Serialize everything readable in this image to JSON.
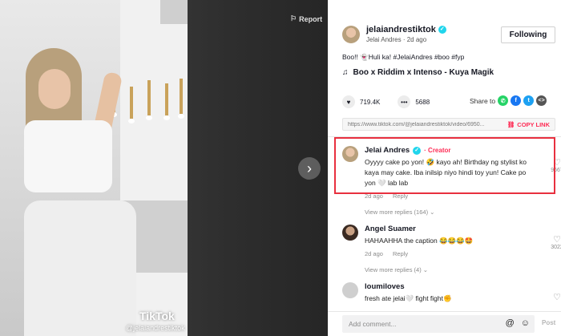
{
  "player": {
    "report_label": "Report",
    "tiktok_logo_text": "TikTok",
    "watermark_handle": "@jelaiandrestiktok"
  },
  "post": {
    "username": "jelaiandrestiktok",
    "display_name": "Jelai Andres",
    "age": "2d ago",
    "follow_label": "Following",
    "caption": "Boo!! 👻Huli ka! #JelaiAndres #boo #fyp",
    "music_title": "Boo x Riddim x Intenso - Kuya Magik",
    "likes": "719.4K",
    "comments_count": "5688",
    "share_label": "Share to",
    "share_icons": [
      "whatsapp-icon",
      "facebook-icon",
      "twitter-icon",
      "embed-icon"
    ],
    "link_url": "https://www.tiktok.com/@jelaiandrestiktok/video/6950...",
    "copy_link_label": "COPY LINK"
  },
  "comments": [
    {
      "name": "Jelai Andres",
      "badge": "· Creator",
      "text": "Oyyyy cake po yon! 🤣 kayo ah! Birthday ng stylist ko kaya may cake. Iba inilsip niyo hindi toy yun! Cake po yon 🤍 lab lab",
      "date": "2d ago",
      "reply_label": "Reply",
      "likes": "9667",
      "view_more": "View more replies (164) ⌄"
    },
    {
      "name": "Angel Suamer",
      "text": "HAHAAHHA the caption 😂😂😂🤩",
      "date": "2d ago",
      "reply_label": "Reply",
      "likes": "3022",
      "view_more": "View more replies (4) ⌄"
    },
    {
      "name": "loumiloves",
      "text": "fresh ate jelai🤍 fight fight✊",
      "date": "",
      "reply_label": "",
      "likes": "",
      "view_more": ""
    }
  ],
  "composer": {
    "placeholder": "Add comment...",
    "post_label": "Post"
  },
  "colors": {
    "accent": "#fe2c55",
    "verified": "#20d5ec",
    "highlight_box": "#e8303f"
  }
}
